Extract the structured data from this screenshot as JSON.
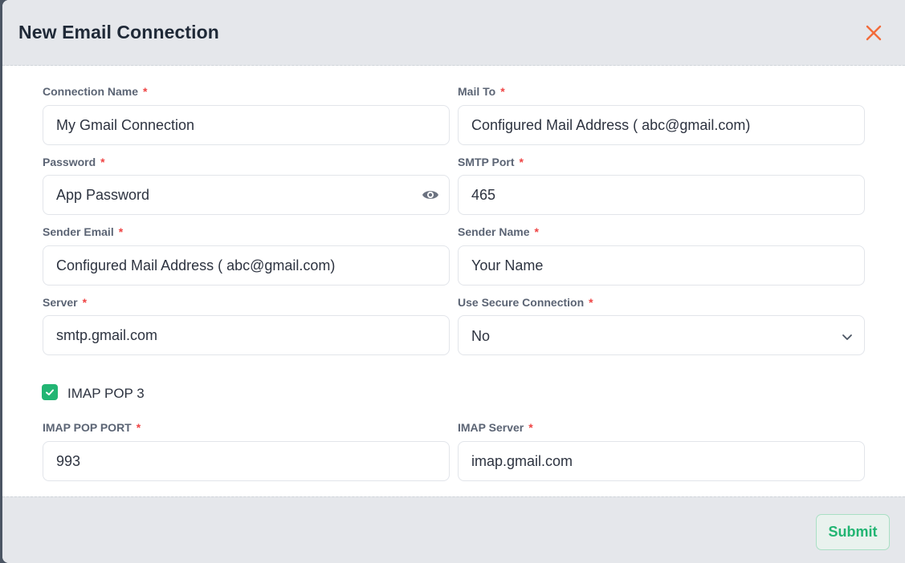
{
  "modal": {
    "title": "New Email Connection",
    "required_marker": "*"
  },
  "fields": {
    "connection_name": {
      "label": "Connection Name",
      "value": "My Gmail Connection"
    },
    "mail_to": {
      "label": "Mail To",
      "value": "Configured Mail Address ( abc@gmail.com)"
    },
    "password": {
      "label": "Password",
      "value": "App Password"
    },
    "smtp_port": {
      "label": "SMTP Port",
      "value": "465"
    },
    "sender_email": {
      "label": "Sender Email",
      "value": "Configured Mail Address ( abc@gmail.com)"
    },
    "sender_name": {
      "label": "Sender Name",
      "value": "Your Name"
    },
    "server": {
      "label": "Server",
      "value": "smtp.gmail.com"
    },
    "secure_connection": {
      "label": "Use Secure Connection",
      "value": "No"
    },
    "imap_pop_port": {
      "label": "IMAP POP PORT",
      "value": "993"
    },
    "imap_server": {
      "label": "IMAP Server",
      "value": "imap.gmail.com"
    }
  },
  "imap_checkbox": {
    "label": "IMAP POP 3",
    "checked": true
  },
  "footer": {
    "submit_label": "Submit"
  },
  "icons": {
    "close": "close-icon",
    "password_toggle": "eye-icon",
    "select": "chevron-down-icon",
    "checkbox": "check-icon"
  },
  "colors": {
    "header_bg": "#e5e7eb",
    "close": "#f26b3a",
    "accent_green": "#22b573",
    "required": "#ef4444",
    "label": "#5b6474"
  }
}
